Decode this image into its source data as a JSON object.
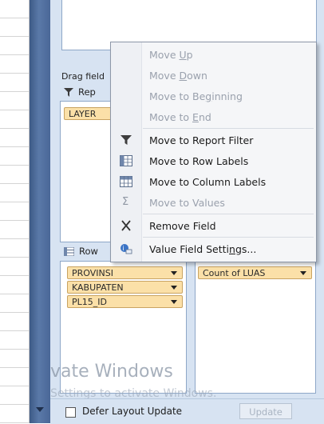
{
  "menu": {
    "items": [
      {
        "pre": "Move ",
        "key": "U",
        "post": "p",
        "enabled": false,
        "icon": ""
      },
      {
        "pre": "Move ",
        "key": "D",
        "post": "own",
        "enabled": false,
        "icon": ""
      },
      {
        "pre": "Move to Be",
        "key": "g",
        "post": "inning",
        "enabled": false,
        "icon": ""
      },
      {
        "pre": "Move to ",
        "key": "E",
        "post": "nd",
        "enabled": false,
        "icon": ""
      },
      {
        "pre": "Move to Report Filter",
        "key": "",
        "post": "",
        "enabled": true,
        "icon": "filter-icon"
      },
      {
        "pre": "Move to Row Labels",
        "key": "",
        "post": "",
        "enabled": true,
        "icon": "row-labels-icon"
      },
      {
        "pre": "Move to Column Labels",
        "key": "",
        "post": "",
        "enabled": true,
        "icon": "column-labels-icon"
      },
      {
        "pre": "Move to Values",
        "key": "",
        "post": "",
        "enabled": false,
        "icon": "sigma-icon"
      },
      {
        "pre": "Remove Field",
        "key": "",
        "post": "",
        "enabled": true,
        "icon": "remove-x-icon"
      },
      {
        "pre": "Value Field Setti",
        "key": "n",
        "post": "gs...",
        "enabled": true,
        "icon": "field-settings-icon"
      }
    ]
  },
  "panel": {
    "drag_label": "Drag field",
    "report_filter_head": "Rep",
    "report_filter_field": "LAYER",
    "row_labels_head": "Row",
    "row_fields": [
      "PROVINSI",
      "KABUPATEN",
      "PL15_ID"
    ],
    "values_field": "Count of LUAS",
    "defer_label": "Defer Layout Update",
    "update_button": "Update"
  },
  "watermark": {
    "line1": "vate Windows",
    "line2": "Settings to activate Windows."
  },
  "colors": {
    "panel_bg": "#d7e3f2",
    "field_pill": "#fbe0a8",
    "menu_bg": "#f5f6f8"
  }
}
